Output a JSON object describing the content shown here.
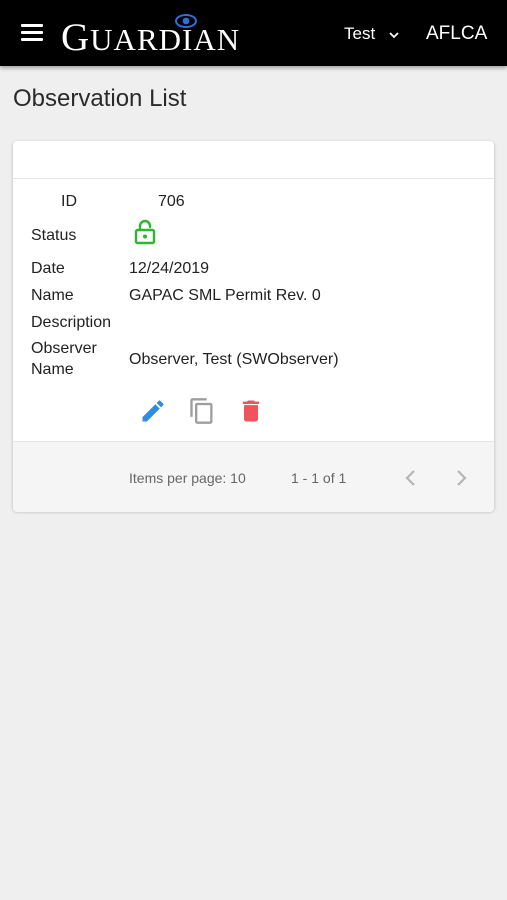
{
  "header": {
    "logo_text": "Guardian",
    "user": "Test",
    "org": "AFLCA"
  },
  "page": {
    "title": "Observation List"
  },
  "observation": {
    "id_label": "ID",
    "id_value": "706",
    "status_label": "Status",
    "status_icon": "lock-open-icon",
    "status_color": "#2fb52f",
    "date_label": "Date",
    "date_value": "12/24/2019",
    "name_label": "Name",
    "name_value": "GAPAC SML Permit Rev. 0",
    "description_label": "Description",
    "description_value": "",
    "observer_label_line1": "Observer",
    "observer_label_line2": "Name",
    "observer_value": "Observer, Test (SWObserver)"
  },
  "actions": {
    "edit_icon": "pencil-icon",
    "edit_color": "#2f8de4",
    "copy_icon": "copy-icon",
    "copy_color": "#9e9e9e",
    "delete_icon": "trash-icon",
    "delete_color": "#f0525e"
  },
  "pagination": {
    "items_per_page": "Items per page: 10",
    "range": "1 - 1 of 1"
  }
}
